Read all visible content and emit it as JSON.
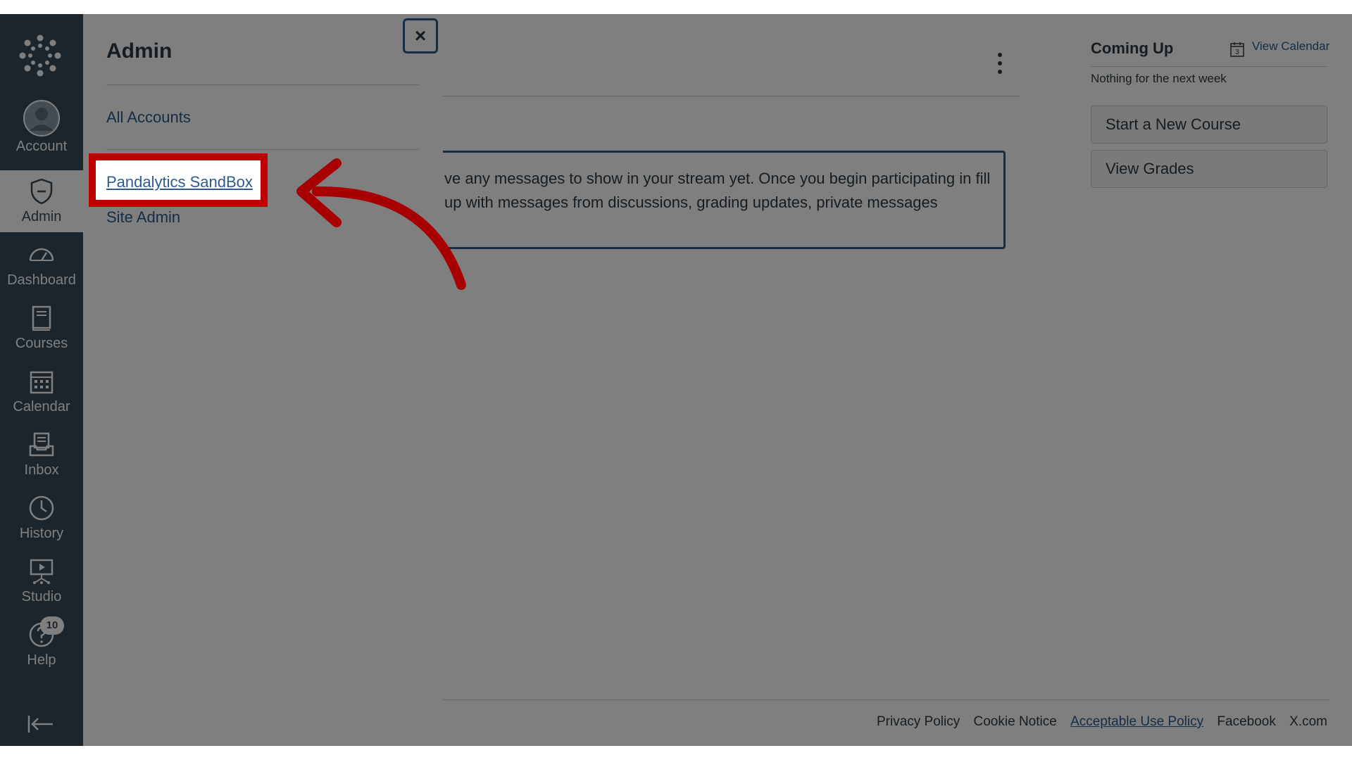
{
  "nav": {
    "items": [
      {
        "label": "Account"
      },
      {
        "label": "Admin"
      },
      {
        "label": "Dashboard"
      },
      {
        "label": "Courses"
      },
      {
        "label": "Calendar"
      },
      {
        "label": "Inbox"
      },
      {
        "label": "History"
      },
      {
        "label": "Studio"
      },
      {
        "label": "Help",
        "badge": "10"
      }
    ]
  },
  "main": {
    "stream_text": "ve any messages to show in your stream yet. Once you begin participating in fill up with messages from discussions, grading updates, private messages"
  },
  "rail": {
    "title": "Coming Up",
    "view_calendar": "View Calendar",
    "calendar_icon_day": "3",
    "subtitle": "Nothing for the next week",
    "start_course": "Start a New Course",
    "view_grades": "View Grades"
  },
  "footer": {
    "privacy": "Privacy Policy",
    "cookie": "Cookie Notice",
    "aup": "Acceptable Use Policy",
    "facebook": "Facebook",
    "x": "X.com"
  },
  "tray": {
    "title": "Admin",
    "close": "×",
    "all_accounts": "All Accounts",
    "sandbox": "Pandalytics SandBox",
    "site_admin": "Site Admin"
  },
  "colors": {
    "nav_bg": "#394b58",
    "link": "#2d5b8c",
    "highlight": "#c00000"
  }
}
